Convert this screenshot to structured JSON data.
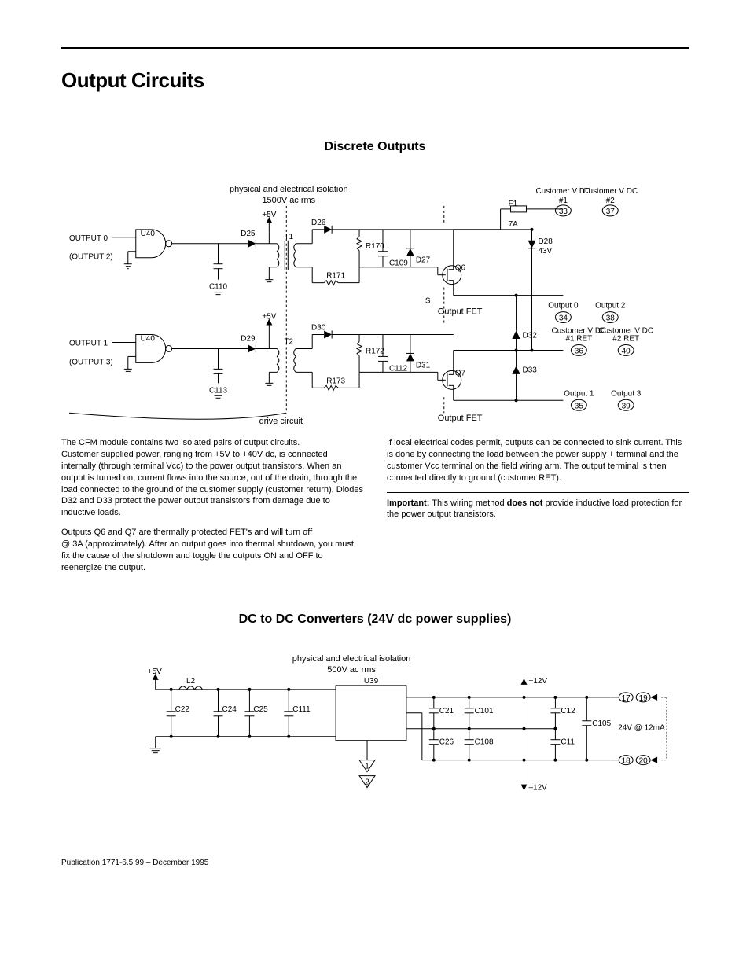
{
  "header": {
    "title": "Output Circuits"
  },
  "section1": {
    "heading": "Discrete Outputs",
    "diagram": {
      "iso_label": "physical and electrical isolation",
      "iso_value": "1500V ac rms",
      "vplus": "+5V",
      "out0": "OUTPUT 0",
      "out0_sub": "(OUTPUT 2)",
      "out1": "OUTPUT 1",
      "out1_sub": "(OUTPUT 3)",
      "u40": "U40",
      "c110": "C110",
      "c113": "C113",
      "d25": "D25",
      "d26": "D26",
      "d29": "D29",
      "d30": "D30",
      "t1": "T1",
      "t2": "T2",
      "r170": "R170",
      "r171": "R171",
      "r172": "R172",
      "r173": "R173",
      "c109": "C109",
      "c112": "C112",
      "d27": "D27",
      "d31": "D31",
      "q6": "Q6",
      "q7": "Q7",
      "s": "S",
      "output_fet": "Output FET",
      "f1": "F1",
      "f1_val": "7A",
      "d28": "D28",
      "d28_val": "43V",
      "d32": "D32",
      "d33": "D33",
      "cust_vdc1": "Customer V DC\n#1",
      "cust_vdc2": "Customer V DC\n#2",
      "cust_vdc1_ret": "Customer V DC\n#1 RET",
      "cust_vdc2_ret": "Customer V DC\n#2 RET",
      "pin33": "33",
      "pin37": "37",
      "pin34": "34",
      "pin38": "38",
      "pin36": "36",
      "pin40": "40",
      "pin35": "35",
      "pin39": "39",
      "output0_lbl": "Output 0",
      "output1_lbl": "Output 1",
      "output2_lbl": "Output 2",
      "output3_lbl": "Output 3",
      "drive_circuit": "drive circuit"
    },
    "text": {
      "p1": "The CFM module contains two isolated pairs of output circuits.",
      "p2": "Customer supplied power, ranging from +5V to +40V dc, is connected internally (through terminal Vcc) to the power output transistors.  When an output is turned on, current flows into the source, out of the drain, through the load connected to the ground of the customer supply (customer return). Diodes D32 and D33 protect the power output transistors from damage due to inductive loads.",
      "p3": "Outputs Q6 and Q7 are thermally protected FET's and will turn off",
      "p4": "@ 3A (approximately).  After an output goes into thermal shutdown, you must fix the cause of the shutdown and toggle the outputs ON and OFF to reenergize the output.",
      "p5": "If local electrical codes permit, outputs can be connected to sink current. This is done by connecting the load between the power supply + terminal and the customer Vcc terminal on the field wiring arm.  The output terminal is then connected directly to ground (customer RET).",
      "imp_label": "Important:",
      "imp_text": " This wiring method ",
      "imp_bold": "does not",
      "imp_rest": " provide inductive load protection for the power output transistors."
    }
  },
  "section2": {
    "heading": "DC to DC Converters (24V dc power supplies)",
    "diagram": {
      "iso_label": "physical and electrical isolation",
      "iso_value": "500V ac rms",
      "vplus": "+5V",
      "l2": "L2",
      "c22": "C22",
      "c24": "C24",
      "c25": "C25",
      "c111": "C111",
      "u39": "U39",
      "c21": "C21",
      "c101": "C101",
      "c26": "C26",
      "c108": "C108",
      "p12v": "+12V",
      "m12v": "–12V",
      "c12": "C12",
      "c11": "C11",
      "c105": "C105",
      "v24": "24V @ 12mA",
      "pin17": "17",
      "pin19": "19",
      "pin18": "18",
      "pin20": "20",
      "tri1": "1",
      "tri2": "2"
    }
  },
  "footer": {
    "publication": "Publication 1771-6.5.99 – December 1995"
  }
}
